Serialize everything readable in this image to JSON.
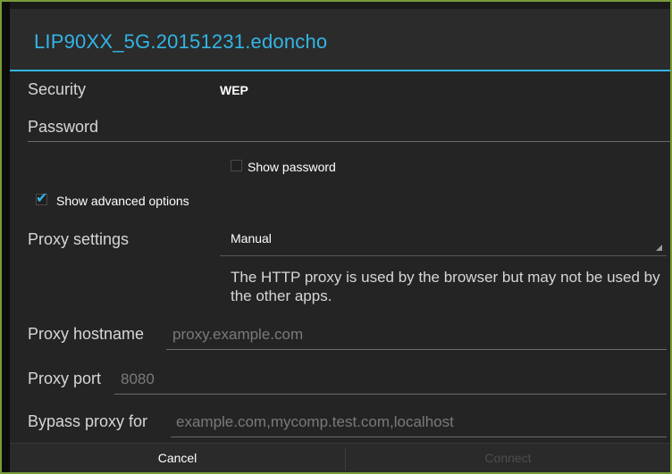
{
  "dialog": {
    "title": "LIP90XX_5G.20151231.edoncho",
    "security_label": "Security",
    "security_value": "WEP",
    "password_label": "Password",
    "password_value": "",
    "show_password_label": "Show password",
    "show_password_checked": false,
    "show_advanced_label": "Show advanced options",
    "show_advanced_checked": true,
    "proxy_settings_label": "Proxy settings",
    "proxy_settings_value": "Manual",
    "proxy_info": "The HTTP proxy is used by the browser but may not be used by the other apps.",
    "proxy_hostname_label": "Proxy hostname",
    "proxy_hostname_placeholder": "proxy.example.com",
    "proxy_port_label": "Proxy port",
    "proxy_port_placeholder": "8080",
    "bypass_label": "Bypass proxy for",
    "bypass_placeholder": "example.com,mycomp.test.com,localhost"
  },
  "buttons": {
    "cancel": "Cancel",
    "connect": "Connect",
    "connect_enabled": false
  },
  "colors": {
    "accent": "#33b5e5",
    "background": "#242424",
    "outer_border": "#7a9a3a"
  }
}
